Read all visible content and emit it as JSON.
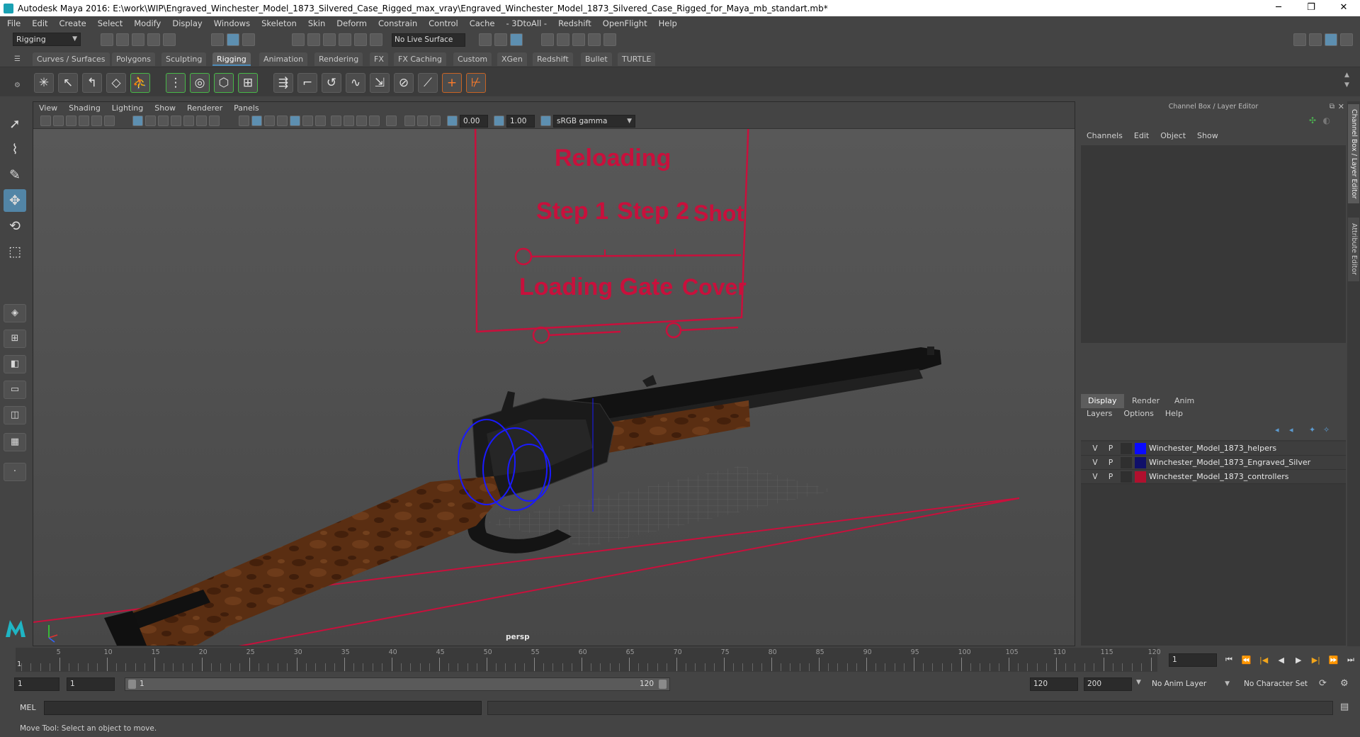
{
  "window": {
    "title": "Autodesk Maya 2016: E:\\work\\WIP\\Engraved_Winchester_Model_1873_Silvered_Case_Rigged_max_vray\\Engraved_Winchester_Model_1873_Silvered_Case_Rigged_for_Maya_mb_standart.mb*",
    "minimize": "─",
    "restore": "❐",
    "close": "✕"
  },
  "menubar": [
    "File",
    "Edit",
    "Create",
    "Select",
    "Modify",
    "Display",
    "Windows",
    "Skeleton",
    "Skin",
    "Deform",
    "Constrain",
    "Control",
    "Cache",
    "- 3DtoAll -",
    "Redshift",
    "OpenFlight",
    "Help"
  ],
  "statusline": {
    "menuset": "Rigging",
    "live_surface": "No Live Surface"
  },
  "shelf": {
    "tabs": [
      "Curves / Surfaces",
      "Polygons",
      "Sculpting",
      "Rigging",
      "Animation",
      "Rendering",
      "FX",
      "FX Caching",
      "Custom",
      "XGen",
      "Redshift",
      "Bullet",
      "TURTLE"
    ],
    "active_tab": "Rigging"
  },
  "viewport": {
    "menu": [
      "View",
      "Shading",
      "Lighting",
      "Show",
      "Renderer",
      "Panels"
    ],
    "field_a": "0.00",
    "field_b": "1.00",
    "color_space": "sRGB gamma",
    "camera_label": "persp",
    "board": {
      "heading": "Reloading",
      "step1": "Step 1",
      "step2": "Step 2",
      "shot": "Shot",
      "loading_gate": "Loading Gate",
      "cover": "Cover"
    }
  },
  "channel_box": {
    "title": "Channel Box / Layer Editor",
    "menu": [
      "Channels",
      "Edit",
      "Object",
      "Show"
    ]
  },
  "layer_editor": {
    "tabs": [
      "Display",
      "Render",
      "Anim"
    ],
    "active_tab": "Display",
    "menu": [
      "Layers",
      "Options",
      "Help"
    ],
    "layers": [
      {
        "v": "V",
        "p": "P",
        "color": "#0a0aff",
        "name": "Winchester_Model_1873_helpers"
      },
      {
        "v": "V",
        "p": "P",
        "color": "#10106a",
        "name": "Winchester_Model_1873_Engraved_Silver"
      },
      {
        "v": "V",
        "p": "P",
        "color": "#b0102e",
        "name": "Winchester_Model_1873_controllers"
      }
    ]
  },
  "side_tabs": [
    "Channel Box / Layer Editor",
    "Attribute Editor"
  ],
  "timeline": {
    "start_frame": "1",
    "tick_labels": [
      "5",
      "10",
      "15",
      "20",
      "25",
      "30",
      "35",
      "40",
      "45",
      "50",
      "55",
      "60",
      "65",
      "70",
      "75",
      "80",
      "85",
      "90",
      "95",
      "100",
      "105",
      "110",
      "115",
      "120"
    ],
    "current_frame": "1",
    "playback_icons": [
      "⏮",
      "⏪",
      "|◀",
      "◀",
      "▶",
      "▶|",
      "⏩",
      "⏭"
    ]
  },
  "range": {
    "start": "1",
    "playback_start": "1",
    "slider_low": "1",
    "slider_high": "120",
    "playback_end": "120",
    "end": "200",
    "anim_layer": "No Anim Layer",
    "character_set": "No Character Set"
  },
  "command_line": {
    "label": "MEL"
  },
  "help_line": "Move Tool: Select an object to move.",
  "colors": {
    "accent": "#5285a6",
    "controller": "#c8103c",
    "helper": "#1a1aff"
  }
}
